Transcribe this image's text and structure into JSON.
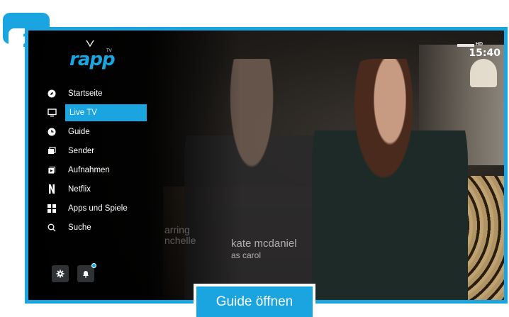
{
  "step": {
    "number": "2"
  },
  "app": {
    "logo_text": "rapp",
    "logo_superscript": "TV"
  },
  "menu": {
    "items": [
      {
        "label": "Startseite",
        "icon": "compass-icon"
      },
      {
        "label": "Live TV",
        "icon": "monitor-icon",
        "active": true
      },
      {
        "label": "Guide",
        "icon": "clock-icon"
      },
      {
        "label": "Sender",
        "icon": "channels-icon"
      },
      {
        "label": "Aufnahmen",
        "icon": "recordings-icon"
      },
      {
        "label": "Netflix",
        "icon": "netflix-icon"
      },
      {
        "label": "Apps und Spiele",
        "icon": "apps-grid-icon"
      },
      {
        "label": "Suche",
        "icon": "search-icon"
      }
    ]
  },
  "bottom": {
    "settings_icon": "gear-icon",
    "notifications_icon": "bell-icon"
  },
  "status": {
    "hd_label": "HD",
    "time": "15:40"
  },
  "video": {
    "credit_left_line1": "arring",
    "credit_left_line2": "nchelle",
    "credit_name": "kate mcdaniel",
    "credit_role": "as carol"
  },
  "caption": {
    "text": "Guide öffnen"
  },
  "colors": {
    "accent": "#1aa5e0",
    "frame": "#1aa5e0"
  }
}
